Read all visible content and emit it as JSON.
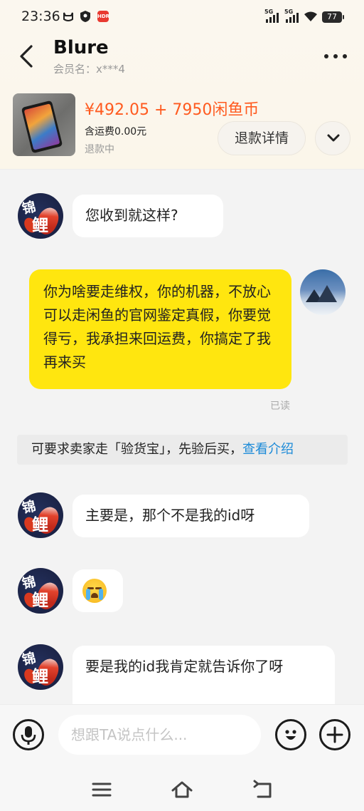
{
  "status_bar": {
    "time": "23:36",
    "signal1": "5G",
    "signal2": "5G",
    "battery": "77",
    "tag": "HDR"
  },
  "header": {
    "title": "Blure",
    "member_label": "会员名：x***4"
  },
  "product": {
    "price": "¥492.05 + 7950闲鱼币",
    "shipping": "含运费0.00元",
    "status": "退款中",
    "refund_details_label": "退款详情"
  },
  "messages": [
    {
      "side": "left",
      "text": "您收到就这样?"
    },
    {
      "side": "right",
      "text": "你为啥要走维权，你的机器，不放心可以走闲鱼的官网鉴定真假，你要觉得亏，我承担来回运费，你搞定了我再来买",
      "read_status": "已读"
    },
    {
      "side": "left",
      "text": "主要是，那个不是我的id呀"
    },
    {
      "side": "left",
      "text": "",
      "emoji": "crying-face"
    },
    {
      "side": "left",
      "text": "要是我的id我肯定就告诉你了呀"
    }
  ],
  "notice": {
    "text": "可要求卖家走「验货宝」，先验后买，",
    "link": "查看介绍"
  },
  "input": {
    "placeholder": "想跟TA说点什么..."
  },
  "colors": {
    "price": "#ff5a1f",
    "my_bubble": "#ffe60f",
    "link": "#1b8ad8"
  }
}
